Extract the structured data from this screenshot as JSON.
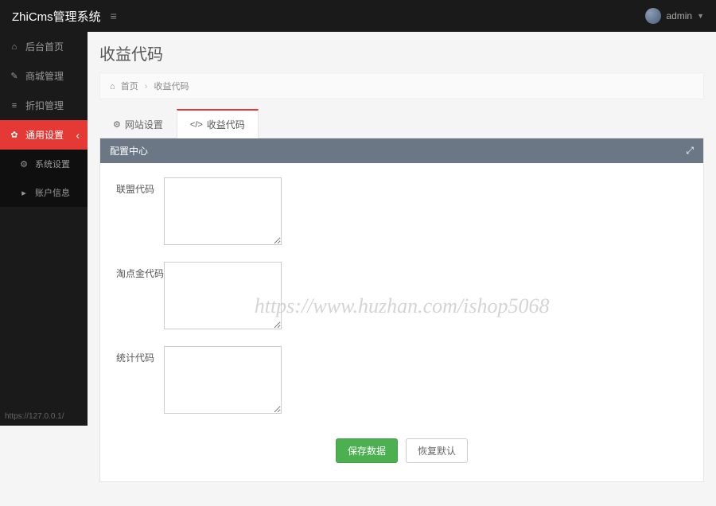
{
  "header": {
    "brand": "ZhiCms管理系统",
    "username": "admin"
  },
  "sidebar": {
    "items": [
      {
        "label": "后台首页",
        "icon": "⌂"
      },
      {
        "label": "商城管理",
        "icon": "✎"
      },
      {
        "label": "折扣管理",
        "icon": "≡"
      },
      {
        "label": "通用设置",
        "icon": "✿",
        "active": true
      }
    ],
    "subitems": [
      {
        "label": "系统设置",
        "icon": "⚙"
      },
      {
        "label": "账户信息",
        "icon": "▸"
      }
    ]
  },
  "page": {
    "title": "收益代码"
  },
  "breadcrumb": {
    "home": "首页",
    "current": "收益代码"
  },
  "tabs": [
    {
      "label": "网站设置",
      "icon": "⚙"
    },
    {
      "label": "收益代码",
      "icon": "</>",
      "active": true
    }
  ],
  "panel": {
    "title": "配置中心"
  },
  "form": {
    "fields": [
      {
        "label": "联盟代码",
        "value": ""
      },
      {
        "label": "淘点金代码",
        "value": ""
      },
      {
        "label": "统计代码",
        "value": ""
      }
    ],
    "save_label": "保存数据",
    "reset_label": "恢复默认"
  },
  "footer": {
    "link": "https://127.0.0.1/"
  },
  "watermark": "https://www.huzhan.com/ishop5068"
}
